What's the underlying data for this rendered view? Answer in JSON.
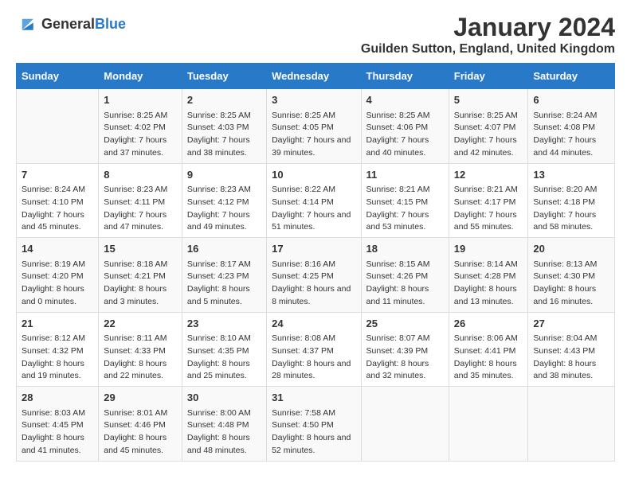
{
  "header": {
    "logo_general": "General",
    "logo_blue": "Blue",
    "month_title": "January 2024",
    "location": "Guilden Sutton, England, United Kingdom"
  },
  "calendar": {
    "days_of_week": [
      "Sunday",
      "Monday",
      "Tuesday",
      "Wednesday",
      "Thursday",
      "Friday",
      "Saturday"
    ],
    "weeks": [
      [
        {
          "day": "",
          "sunrise": "",
          "sunset": "",
          "daylight": ""
        },
        {
          "day": "1",
          "sunrise": "Sunrise: 8:25 AM",
          "sunset": "Sunset: 4:02 PM",
          "daylight": "Daylight: 7 hours and 37 minutes."
        },
        {
          "day": "2",
          "sunrise": "Sunrise: 8:25 AM",
          "sunset": "Sunset: 4:03 PM",
          "daylight": "Daylight: 7 hours and 38 minutes."
        },
        {
          "day": "3",
          "sunrise": "Sunrise: 8:25 AM",
          "sunset": "Sunset: 4:05 PM",
          "daylight": "Daylight: 7 hours and 39 minutes."
        },
        {
          "day": "4",
          "sunrise": "Sunrise: 8:25 AM",
          "sunset": "Sunset: 4:06 PM",
          "daylight": "Daylight: 7 hours and 40 minutes."
        },
        {
          "day": "5",
          "sunrise": "Sunrise: 8:25 AM",
          "sunset": "Sunset: 4:07 PM",
          "daylight": "Daylight: 7 hours and 42 minutes."
        },
        {
          "day": "6",
          "sunrise": "Sunrise: 8:24 AM",
          "sunset": "Sunset: 4:08 PM",
          "daylight": "Daylight: 7 hours and 44 minutes."
        }
      ],
      [
        {
          "day": "7",
          "sunrise": "Sunrise: 8:24 AM",
          "sunset": "Sunset: 4:10 PM",
          "daylight": "Daylight: 7 hours and 45 minutes."
        },
        {
          "day": "8",
          "sunrise": "Sunrise: 8:23 AM",
          "sunset": "Sunset: 4:11 PM",
          "daylight": "Daylight: 7 hours and 47 minutes."
        },
        {
          "day": "9",
          "sunrise": "Sunrise: 8:23 AM",
          "sunset": "Sunset: 4:12 PM",
          "daylight": "Daylight: 7 hours and 49 minutes."
        },
        {
          "day": "10",
          "sunrise": "Sunrise: 8:22 AM",
          "sunset": "Sunset: 4:14 PM",
          "daylight": "Daylight: 7 hours and 51 minutes."
        },
        {
          "day": "11",
          "sunrise": "Sunrise: 8:21 AM",
          "sunset": "Sunset: 4:15 PM",
          "daylight": "Daylight: 7 hours and 53 minutes."
        },
        {
          "day": "12",
          "sunrise": "Sunrise: 8:21 AM",
          "sunset": "Sunset: 4:17 PM",
          "daylight": "Daylight: 7 hours and 55 minutes."
        },
        {
          "day": "13",
          "sunrise": "Sunrise: 8:20 AM",
          "sunset": "Sunset: 4:18 PM",
          "daylight": "Daylight: 7 hours and 58 minutes."
        }
      ],
      [
        {
          "day": "14",
          "sunrise": "Sunrise: 8:19 AM",
          "sunset": "Sunset: 4:20 PM",
          "daylight": "Daylight: 8 hours and 0 minutes."
        },
        {
          "day": "15",
          "sunrise": "Sunrise: 8:18 AM",
          "sunset": "Sunset: 4:21 PM",
          "daylight": "Daylight: 8 hours and 3 minutes."
        },
        {
          "day": "16",
          "sunrise": "Sunrise: 8:17 AM",
          "sunset": "Sunset: 4:23 PM",
          "daylight": "Daylight: 8 hours and 5 minutes."
        },
        {
          "day": "17",
          "sunrise": "Sunrise: 8:16 AM",
          "sunset": "Sunset: 4:25 PM",
          "daylight": "Daylight: 8 hours and 8 minutes."
        },
        {
          "day": "18",
          "sunrise": "Sunrise: 8:15 AM",
          "sunset": "Sunset: 4:26 PM",
          "daylight": "Daylight: 8 hours and 11 minutes."
        },
        {
          "day": "19",
          "sunrise": "Sunrise: 8:14 AM",
          "sunset": "Sunset: 4:28 PM",
          "daylight": "Daylight: 8 hours and 13 minutes."
        },
        {
          "day": "20",
          "sunrise": "Sunrise: 8:13 AM",
          "sunset": "Sunset: 4:30 PM",
          "daylight": "Daylight: 8 hours and 16 minutes."
        }
      ],
      [
        {
          "day": "21",
          "sunrise": "Sunrise: 8:12 AM",
          "sunset": "Sunset: 4:32 PM",
          "daylight": "Daylight: 8 hours and 19 minutes."
        },
        {
          "day": "22",
          "sunrise": "Sunrise: 8:11 AM",
          "sunset": "Sunset: 4:33 PM",
          "daylight": "Daylight: 8 hours and 22 minutes."
        },
        {
          "day": "23",
          "sunrise": "Sunrise: 8:10 AM",
          "sunset": "Sunset: 4:35 PM",
          "daylight": "Daylight: 8 hours and 25 minutes."
        },
        {
          "day": "24",
          "sunrise": "Sunrise: 8:08 AM",
          "sunset": "Sunset: 4:37 PM",
          "daylight": "Daylight: 8 hours and 28 minutes."
        },
        {
          "day": "25",
          "sunrise": "Sunrise: 8:07 AM",
          "sunset": "Sunset: 4:39 PM",
          "daylight": "Daylight: 8 hours and 32 minutes."
        },
        {
          "day": "26",
          "sunrise": "Sunrise: 8:06 AM",
          "sunset": "Sunset: 4:41 PM",
          "daylight": "Daylight: 8 hours and 35 minutes."
        },
        {
          "day": "27",
          "sunrise": "Sunrise: 8:04 AM",
          "sunset": "Sunset: 4:43 PM",
          "daylight": "Daylight: 8 hours and 38 minutes."
        }
      ],
      [
        {
          "day": "28",
          "sunrise": "Sunrise: 8:03 AM",
          "sunset": "Sunset: 4:45 PM",
          "daylight": "Daylight: 8 hours and 41 minutes."
        },
        {
          "day": "29",
          "sunrise": "Sunrise: 8:01 AM",
          "sunset": "Sunset: 4:46 PM",
          "daylight": "Daylight: 8 hours and 45 minutes."
        },
        {
          "day": "30",
          "sunrise": "Sunrise: 8:00 AM",
          "sunset": "Sunset: 4:48 PM",
          "daylight": "Daylight: 8 hours and 48 minutes."
        },
        {
          "day": "31",
          "sunrise": "Sunrise: 7:58 AM",
          "sunset": "Sunset: 4:50 PM",
          "daylight": "Daylight: 8 hours and 52 minutes."
        },
        {
          "day": "",
          "sunrise": "",
          "sunset": "",
          "daylight": ""
        },
        {
          "day": "",
          "sunrise": "",
          "sunset": "",
          "daylight": ""
        },
        {
          "day": "",
          "sunrise": "",
          "sunset": "",
          "daylight": ""
        }
      ]
    ]
  }
}
